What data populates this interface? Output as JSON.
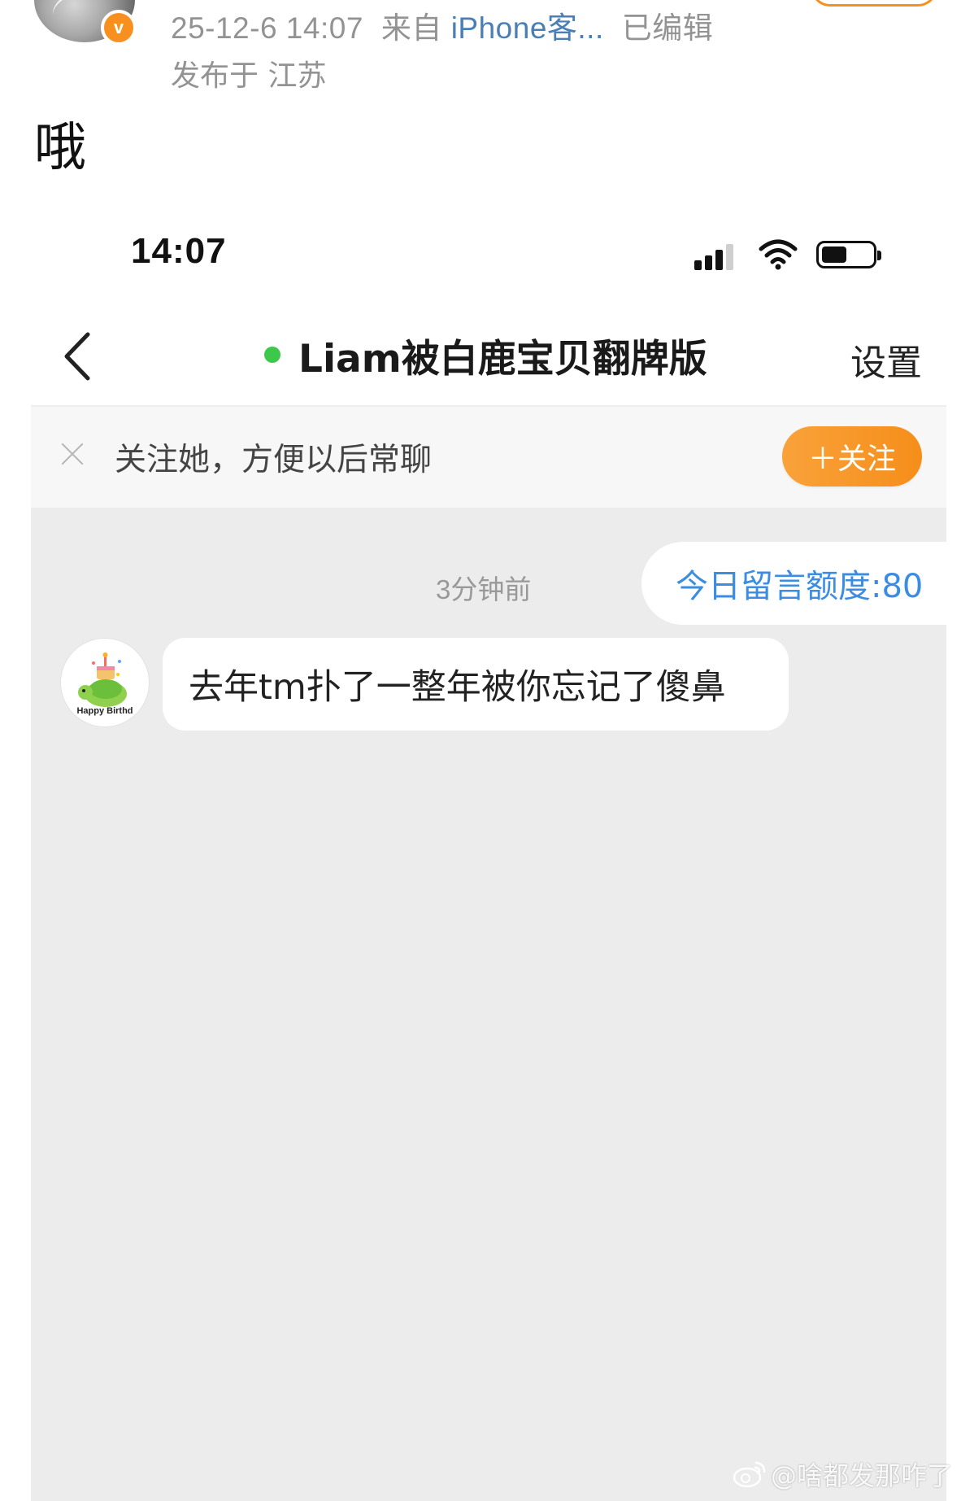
{
  "post": {
    "meta_time": "25-12-6 14:07",
    "meta_from": "来自",
    "meta_source": "iPhone客...",
    "meta_edited": "已编辑",
    "location": "发布于 江苏",
    "text": "哦",
    "badge_letter": "v"
  },
  "phone": {
    "status_time": "14:07",
    "nav": {
      "title": "Liam被白鹿宝贝翻牌版",
      "settings": "设置"
    },
    "follow_bar": {
      "prompt": "关注她，方便以后常聊",
      "button": "＋关注"
    },
    "chat": {
      "timestamp": "3分钟前",
      "quota": "今日留言额度:80",
      "avatar_caption": "Happy Birthd",
      "message": "去年tm扑了一整年被你忘记了傻鼻"
    }
  },
  "watermark": "@啥都发那咋了",
  "colors": {
    "accent_orange": "#f7901e",
    "online_green": "#3cc94b",
    "link_blue": "#3b8de3",
    "chat_bg": "#ececec"
  },
  "icons": [
    "verified-badge",
    "signal-icon",
    "wifi-icon",
    "battery-icon",
    "back-chevron-icon",
    "close-icon",
    "weibo-logo-icon"
  ]
}
